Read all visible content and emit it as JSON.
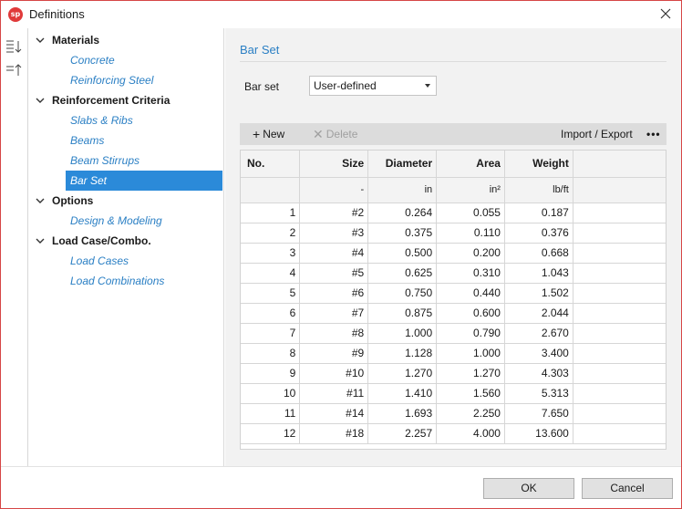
{
  "window": {
    "title": "Definitions",
    "app_icon_text": "sp",
    "accent_color": "#2b8ad9",
    "link_color": "#2a7fc4",
    "border_color": "#d64545"
  },
  "toolstrip": {
    "icons": [
      "expand-all-icon",
      "collapse-all-icon"
    ]
  },
  "tree": {
    "groups": [
      {
        "label": "Materials",
        "items": [
          "Concrete",
          "Reinforcing Steel"
        ]
      },
      {
        "label": "Reinforcement Criteria",
        "items": [
          "Slabs & Ribs",
          "Beams",
          "Beam Stirrups",
          "Bar Set"
        ]
      },
      {
        "label": "Options",
        "items": [
          "Design & Modeling"
        ]
      },
      {
        "label": "Load Case/Combo.",
        "items": [
          "Load Cases",
          "Load Combinations"
        ]
      }
    ],
    "selected": "Bar Set"
  },
  "main": {
    "section_title": "Bar Set",
    "bar_set_label": "Bar set",
    "bar_set_value": "User-defined"
  },
  "toolbar": {
    "new_label": "New",
    "delete_label": "Delete",
    "import_export_label": "Import / Export",
    "more_label": "•••"
  },
  "table": {
    "headers": [
      "No.",
      "Size",
      "Diameter",
      "Area",
      "Weight"
    ],
    "units": [
      "",
      "-",
      "in",
      "in²",
      "lb/ft"
    ],
    "rows": [
      [
        "1",
        "#2",
        "0.264",
        "0.055",
        "0.187"
      ],
      [
        "2",
        "#3",
        "0.375",
        "0.110",
        "0.376"
      ],
      [
        "3",
        "#4",
        "0.500",
        "0.200",
        "0.668"
      ],
      [
        "4",
        "#5",
        "0.625",
        "0.310",
        "1.043"
      ],
      [
        "5",
        "#6",
        "0.750",
        "0.440",
        "1.502"
      ],
      [
        "6",
        "#7",
        "0.875",
        "0.600",
        "2.044"
      ],
      [
        "7",
        "#8",
        "1.000",
        "0.790",
        "2.670"
      ],
      [
        "8",
        "#9",
        "1.128",
        "1.000",
        "3.400"
      ],
      [
        "9",
        "#10",
        "1.270",
        "1.270",
        "4.303"
      ],
      [
        "10",
        "#11",
        "1.410",
        "1.560",
        "5.313"
      ],
      [
        "11",
        "#14",
        "1.693",
        "2.250",
        "7.650"
      ],
      [
        "12",
        "#18",
        "2.257",
        "4.000",
        "13.600"
      ]
    ]
  },
  "footer": {
    "ok_label": "OK",
    "cancel_label": "Cancel"
  }
}
